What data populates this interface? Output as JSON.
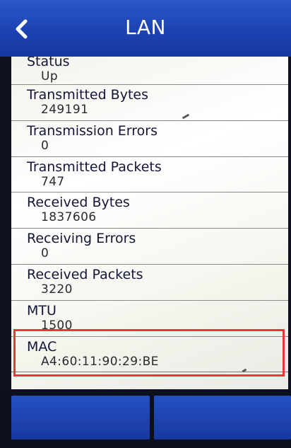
{
  "header": {
    "title": "LAN",
    "back_icon": "chevron-left-icon"
  },
  "rows": [
    {
      "label": "Status",
      "value": "Up"
    },
    {
      "label": "Transmitted Bytes",
      "value": "249191"
    },
    {
      "label": "Transmission Errors",
      "value": "0"
    },
    {
      "label": "Transmitted Packets",
      "value": "747"
    },
    {
      "label": "Received Bytes",
      "value": "1837606"
    },
    {
      "label": "Receiving Errors",
      "value": "0"
    },
    {
      "label": "Received Packets",
      "value": "3220"
    },
    {
      "label": "MTU",
      "value": "1500"
    },
    {
      "label": "MAC",
      "value": "A4:60:11:90:29:BE"
    }
  ],
  "colors": {
    "header": "#1c43b2",
    "highlight": "#e8363c",
    "button": "#1d42ac"
  }
}
